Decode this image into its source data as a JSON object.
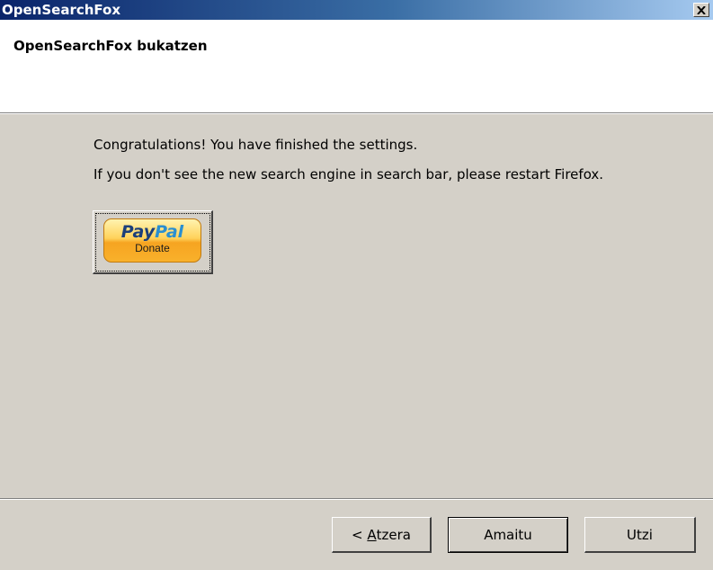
{
  "window": {
    "title": "OpenSearchFox",
    "close_glyph": "X"
  },
  "header": {
    "title": "OpenSearchFox bukatzen"
  },
  "content": {
    "message_line1": "Congratulations! You have finished the settings.",
    "message_line2": "If you don't see the new search engine in search bar, please restart Firefox.",
    "paypal": {
      "logo_pay": "Pay",
      "logo_pal": "Pal",
      "label": "Donate"
    }
  },
  "buttons": {
    "back_prefix": "< ",
    "back_mnemonic": "A",
    "back_rest": "tzera",
    "finish": "Amaitu",
    "cancel": "Utzi"
  },
  "colors": {
    "window_bg": "#d4d0c8",
    "title_bar_start": "#0a246a",
    "title_bar_end": "#a6caf0",
    "paypal_orange": "#f6a421",
    "paypal_blue": "#1b3f7a"
  }
}
